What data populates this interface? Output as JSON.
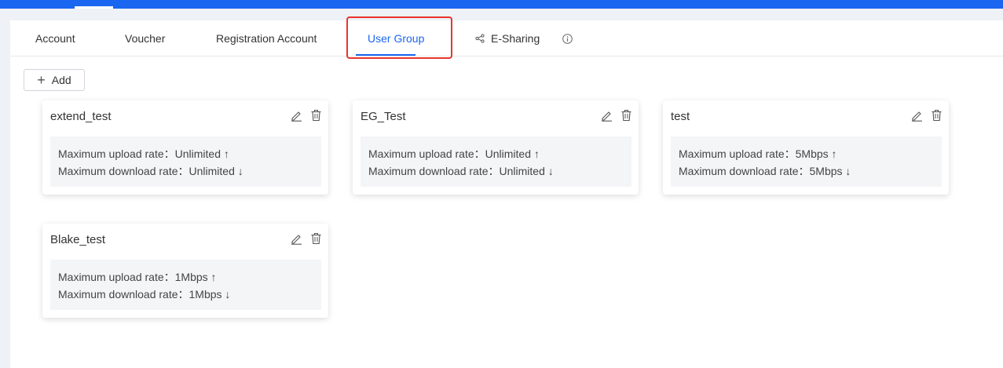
{
  "tabs": [
    {
      "label": "Account"
    },
    {
      "label": "Voucher"
    },
    {
      "label": "Registration Account"
    },
    {
      "label": "User Group",
      "active": true
    },
    {
      "label": "E-Sharing",
      "icon": "share-icon"
    }
  ],
  "info_icon": "info-icon",
  "toolbar": {
    "add_label": "Add",
    "add_icon": "plus-icon"
  },
  "labels": {
    "upload": "Maximum upload rate：",
    "download": "Maximum download rate："
  },
  "groups": [
    {
      "name": "extend_test",
      "upload": "Unlimited ↑",
      "download": "Unlimited ↓"
    },
    {
      "name": "EG_Test",
      "upload": "Unlimited ↑",
      "download": "Unlimited ↓"
    },
    {
      "name": "test",
      "upload": "5Mbps ↑",
      "download": "5Mbps ↓"
    },
    {
      "name": "Blake_test",
      "upload": "1Mbps ↑",
      "download": "1Mbps ↓"
    }
  ],
  "card_icons": {
    "edit": "edit-icon",
    "delete": "trash-icon"
  },
  "colors": {
    "brand": "#1a66f0",
    "highlight": "#e8352c",
    "background": "#eef1f5"
  }
}
